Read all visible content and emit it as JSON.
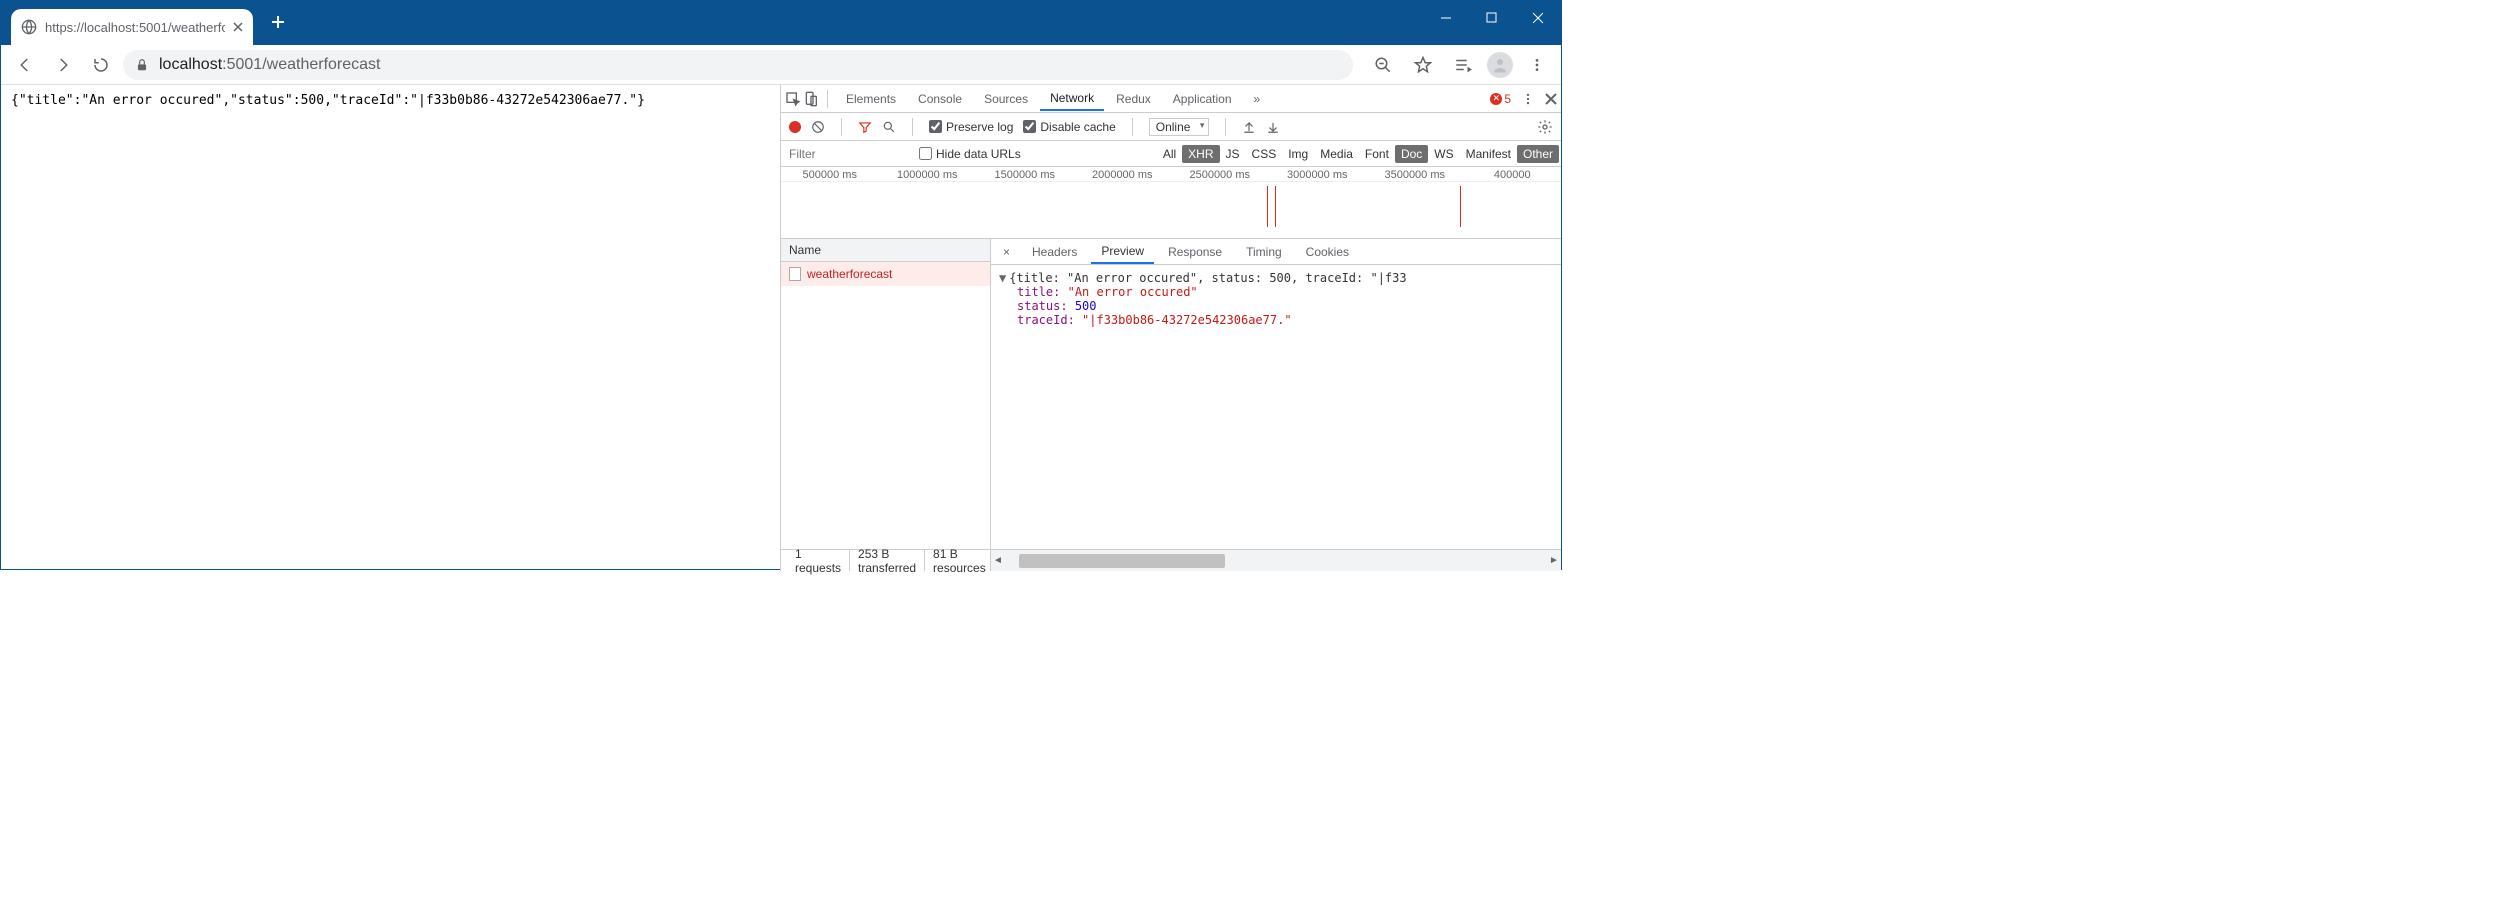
{
  "browser": {
    "tab_title": "https://localhost:5001/weatherfo",
    "url_host": "localhost",
    "url_port_path": ":5001/weatherforecast"
  },
  "page_body": "{\"title\":\"An error occured\",\"status\":500,\"traceId\":\"|f33b0b86-43272e542306ae77.\"}",
  "devtools": {
    "tabs": [
      "Elements",
      "Console",
      "Sources",
      "Network",
      "Redux",
      "Application"
    ],
    "active_tab": "Network",
    "error_count": "5",
    "toolbar": {
      "preserve_log_label": "Preserve log",
      "disable_cache_label": "Disable cache",
      "throttling": "Online"
    },
    "filter": {
      "placeholder": "Filter",
      "hide_data_urls": "Hide data URLs",
      "types": [
        "All",
        "XHR",
        "JS",
        "CSS",
        "Img",
        "Media",
        "Font",
        "Doc",
        "WS",
        "Manifest",
        "Other"
      ],
      "active_types": [
        "XHR",
        "Doc",
        "Other"
      ]
    },
    "timeline_ticks": [
      "500000 ms",
      "1000000 ms",
      "1500000 ms",
      "2000000 ms",
      "2500000 ms",
      "3000000 ms",
      "3500000 ms",
      "400000"
    ],
    "requests": {
      "header": "Name",
      "rows": [
        "weatherforecast"
      ]
    },
    "detail_tabs": [
      "Headers",
      "Preview",
      "Response",
      "Timing",
      "Cookies"
    ],
    "active_detail_tab": "Preview",
    "preview": {
      "summary": "{title: \"An error occured\", status: 500, traceId: \"|f33",
      "title_key": "title:",
      "title_val": "\"An error occured\"",
      "status_key": "status:",
      "status_val": "500",
      "trace_key": "traceId:",
      "trace_val": "\"|f33b0b86-43272e542306ae77.\""
    },
    "status": {
      "requests": "1 requests",
      "transferred": "253 B transferred",
      "resources": "81 B resources"
    }
  }
}
